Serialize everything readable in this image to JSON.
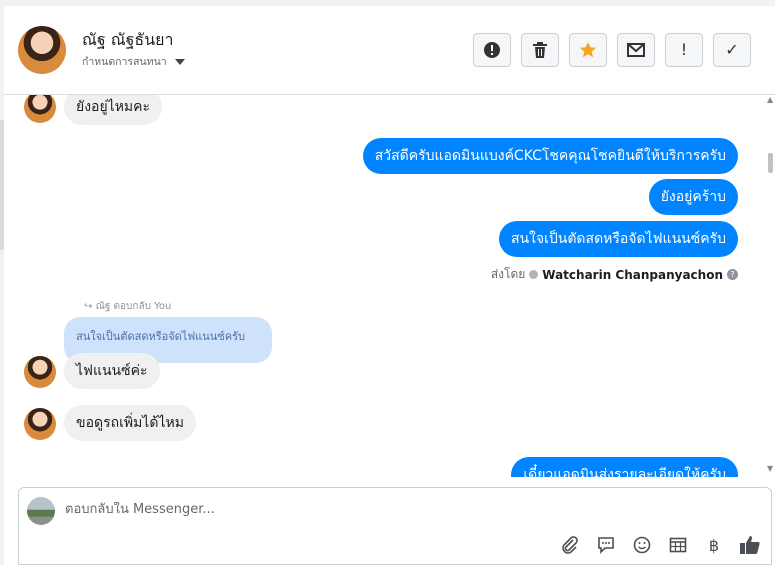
{
  "header": {
    "contact_name": "ณัฐ ณัฐธันยา",
    "subtitle": "กำหนดการสนทนา",
    "buttons": {
      "spam": "!",
      "delete": "🗑",
      "star": "★",
      "mail": "✉",
      "important": "!",
      "done": "✓"
    }
  },
  "thread": {
    "messages": [
      {
        "id": "m1",
        "from": "contact",
        "text": "ยังอยู่ไหมคะ"
      },
      {
        "id": "m2",
        "from": "page",
        "text": "สวัสดีครับแอดมินแบงค์CKCโชคคุณโชคยินดีให้บริการครับ"
      },
      {
        "id": "m3",
        "from": "page",
        "text": "ยังอยู่คร้าบ"
      },
      {
        "id": "m4",
        "from": "page",
        "text": "สนใจเป็นตัดสดหรือจัดไฟแนนซ์ครับ"
      },
      {
        "id": "m5",
        "from": "contact",
        "text": "ไฟแนนซ์ค่ะ"
      },
      {
        "id": "m6",
        "from": "contact",
        "text": "ขอดูรถเพิ่มได้ไหม"
      },
      {
        "id": "m7",
        "from": "page",
        "text": "เดี๋ยวแอดมินส่งรายละเอียดให้ครับ"
      }
    ],
    "sent_by_label": "ส่งโดย",
    "sent_by_name": "Watcharin Chanpanyachon",
    "reply_label": "ณัฐ ตอบกลับ You",
    "quoted_text": "สนใจเป็นตัดสดหรือจัดไฟแนนซ์ครับ"
  },
  "composer": {
    "placeholder": "ตอบกลับใน Messenger...",
    "value": ""
  },
  "colors": {
    "outgoing": "#0084ff",
    "incoming": "#f0f0f0",
    "quote": "#cfe2fb",
    "star": "#f5a623"
  }
}
